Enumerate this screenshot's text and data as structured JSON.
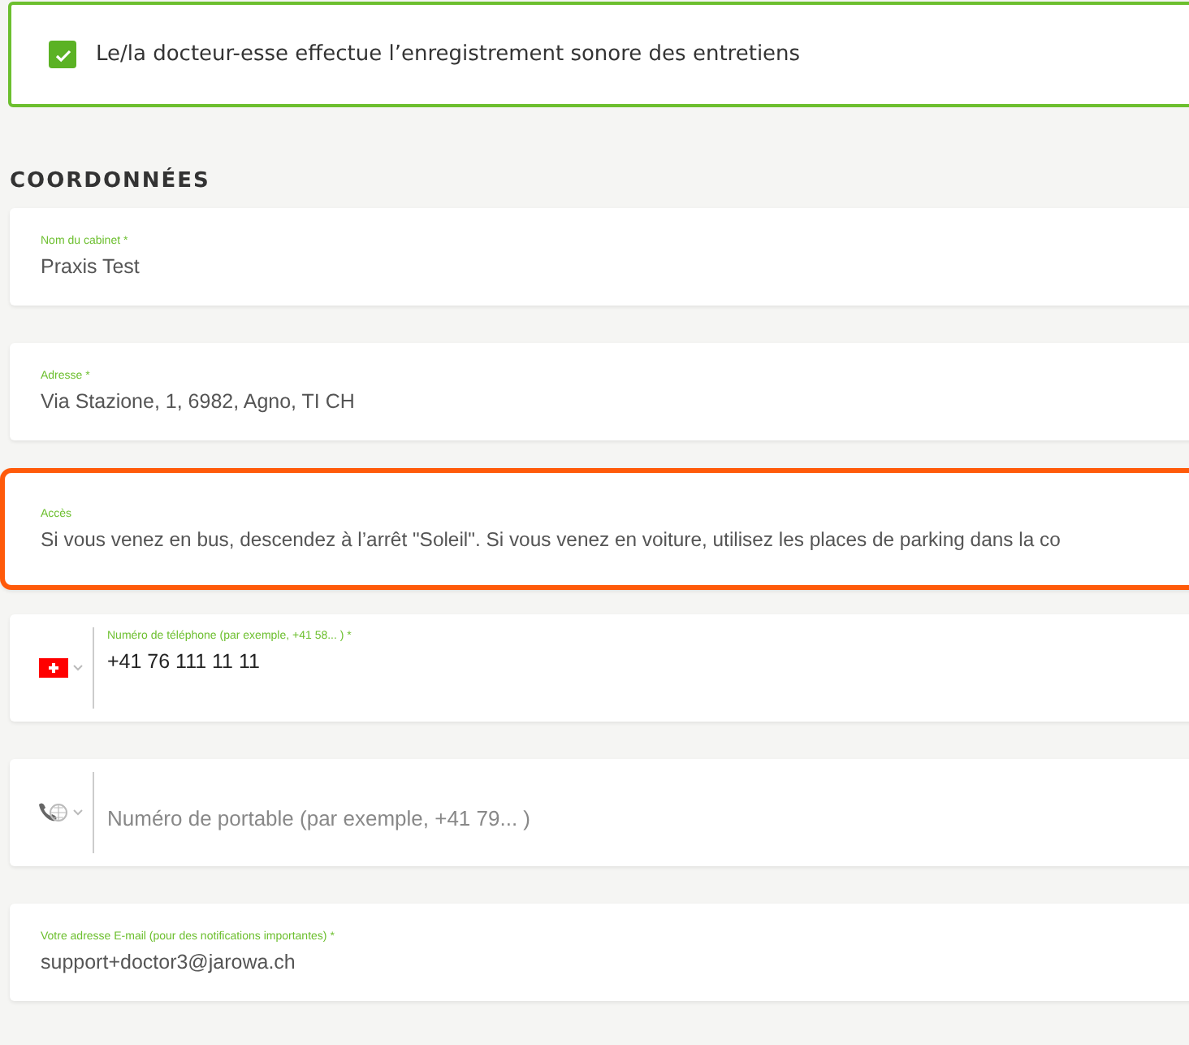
{
  "consent": {
    "label": "Le/la docteur-esse effectue l’enregistrement sonore des entretiens",
    "checked": true
  },
  "section_title": "COORDONNÉES",
  "fields": [
    {
      "kind": "text",
      "label": "Nom du cabinet *",
      "value": "Praxis Test",
      "focused": false
    },
    {
      "kind": "text",
      "label": "Adresse *",
      "value": "Via Stazione, 1, 6982, Agno, TI CH",
      "focused": false
    },
    {
      "kind": "text",
      "label": "Accès",
      "value": "Si vous venez en bus, descendez à l’arrêt \"Soleil\". Si vous venez en voiture, utilisez les places de parking dans la co",
      "focused": true
    },
    {
      "kind": "phone",
      "label": "Numéro de téléphone (par exemple, +41 58... ) *",
      "value": "+41 76 111 11 11",
      "country_selected": true,
      "focused": false
    },
    {
      "kind": "phone",
      "placeholder": "Numéro de portable (par exemple, +41 79... )",
      "country_selected": false,
      "focused": false
    },
    {
      "kind": "text",
      "label": "Votre adresse E-mail (pour des notifications importantes) *",
      "value": "support+doctor3@jarowa.ch",
      "focused": false
    }
  ]
}
